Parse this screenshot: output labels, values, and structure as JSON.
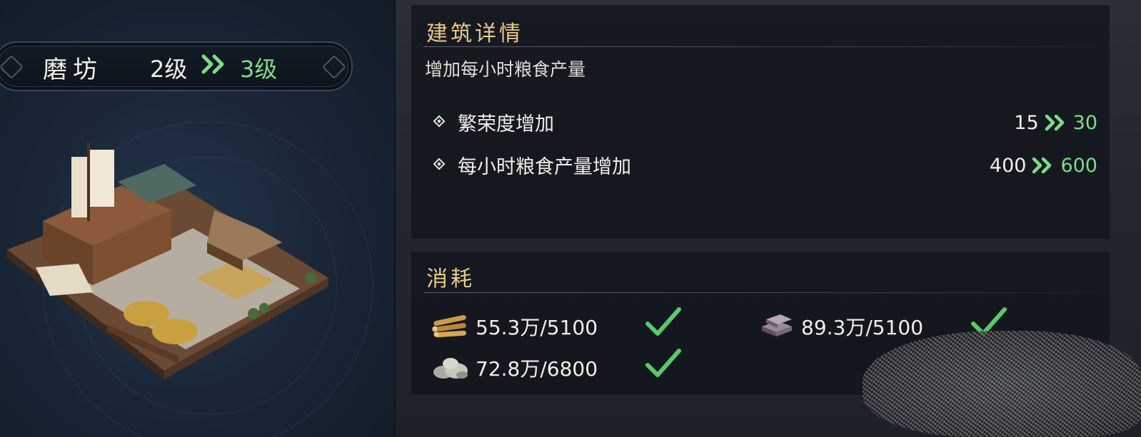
{
  "building": {
    "name": "磨坊",
    "level_from": "2级",
    "level_to": "3级"
  },
  "details": {
    "title": "建筑详情",
    "description": "增加每小时粮食产量",
    "stats": [
      {
        "label": "繁荣度增加",
        "from": "15",
        "to": "30"
      },
      {
        "label": "每小时粮食产量增加",
        "from": "400",
        "to": "600"
      }
    ]
  },
  "consume": {
    "title": "消耗",
    "resources": [
      {
        "icon": "wood-logs-icon",
        "text": "55.3万/5100",
        "sufficient": true
      },
      {
        "icon": "iron-ingot-icon",
        "text": "89.3万/5100",
        "sufficient": true
      },
      {
        "icon": "stone-icon",
        "text": "72.8万/6800",
        "sufficient": true
      }
    ]
  },
  "colors": {
    "accent_green": "#7fdb8a",
    "title_gold": "#e8c98a",
    "panel_bg": "#12161c"
  }
}
